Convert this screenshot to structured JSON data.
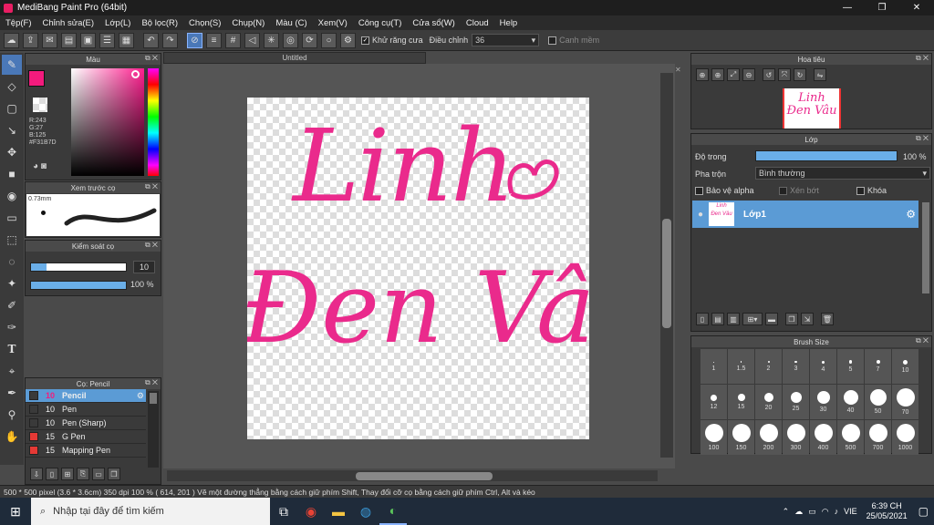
{
  "window": {
    "title": "MediBang Paint Pro (64bit)",
    "min": "—",
    "max": "❐",
    "close": "✕"
  },
  "menu": [
    "Tệp(F)",
    "Chỉnh sửa(E)",
    "Lớp(L)",
    "Bộ lọc(R)",
    "Chọn(S)",
    "Chụp(N)",
    "Màu (C)",
    "Xem(V)",
    "Công cụ(T)",
    "Cửa sổ(W)",
    "Cloud",
    "Help"
  ],
  "toolbar": {
    "antialias_label": "Khử răng cưa",
    "correction_label": "Điều chỉnh",
    "correction_value": "36",
    "smooth_label": "Canh mềm"
  },
  "color_panel": {
    "title": "Màu",
    "r": "R:243",
    "g": "G:27",
    "b": "B:125",
    "hex": "#F31B7D",
    "accent": "#F31B7D"
  },
  "brush_preview": {
    "title": "Xem trước cọ",
    "size": "0.73mm"
  },
  "brush_control": {
    "title": "Kiểm soát cọ",
    "size_value": "10",
    "opacity_value": "100 %"
  },
  "brush_list": {
    "title": "Cọ: Pencil",
    "items": [
      {
        "num": "10",
        "name": "Pencil",
        "color": "#3a3a3a",
        "selected": true
      },
      {
        "num": "10",
        "name": "Pen",
        "color": "#3a3a3a",
        "selected": false
      },
      {
        "num": "10",
        "name": "Pen (Sharp)",
        "color": "#3a3a3a",
        "selected": false
      },
      {
        "num": "15",
        "name": "G Pen",
        "color": "#e53935",
        "selected": false
      },
      {
        "num": "15",
        "name": "Mapping Pen",
        "color": "#e53935",
        "selected": false
      }
    ]
  },
  "canvas": {
    "tab": "Untitled",
    "line1": "Linh",
    "line2": "Đen Vâu"
  },
  "navigator": {
    "title": "Hoa tiêu",
    "thumb_line1": "Linh",
    "thumb_line2": "Đen Vâu"
  },
  "layer_panel": {
    "title": "Lớp",
    "opacity_label": "Độ trong",
    "opacity_value": "100 %",
    "blend_label": "Pha trộn",
    "blend_value": "Bình thường",
    "protect_alpha": "Bảo vệ alpha",
    "clipping": "Xén bớt",
    "lock": "Khóa",
    "layer_name": "Lớp1"
  },
  "brush_size": {
    "title": "Brush Size",
    "sizes": [
      "1",
      "1.5",
      "2",
      "3",
      "4",
      "5",
      "7",
      "10",
      "12",
      "15",
      "20",
      "25",
      "30",
      "40",
      "50",
      "70",
      "100",
      "150",
      "200",
      "300",
      "400",
      "500",
      "700",
      "1000"
    ]
  },
  "status": "500 * 500 pixel   (3.6 * 3.6cm)   350 dpi   100 %   ( 614, 201 )   Vẽ một đường thẳng bằng cách giữ phím Shift, Thay đổi cỡ cọ bằng cách giữ phím Ctrl, Alt và kéo",
  "taskbar": {
    "search_placeholder": "Nhập tại đây để tìm kiếm",
    "lang": "VIE",
    "time": "6:39 CH",
    "date": "25/05/2021"
  }
}
